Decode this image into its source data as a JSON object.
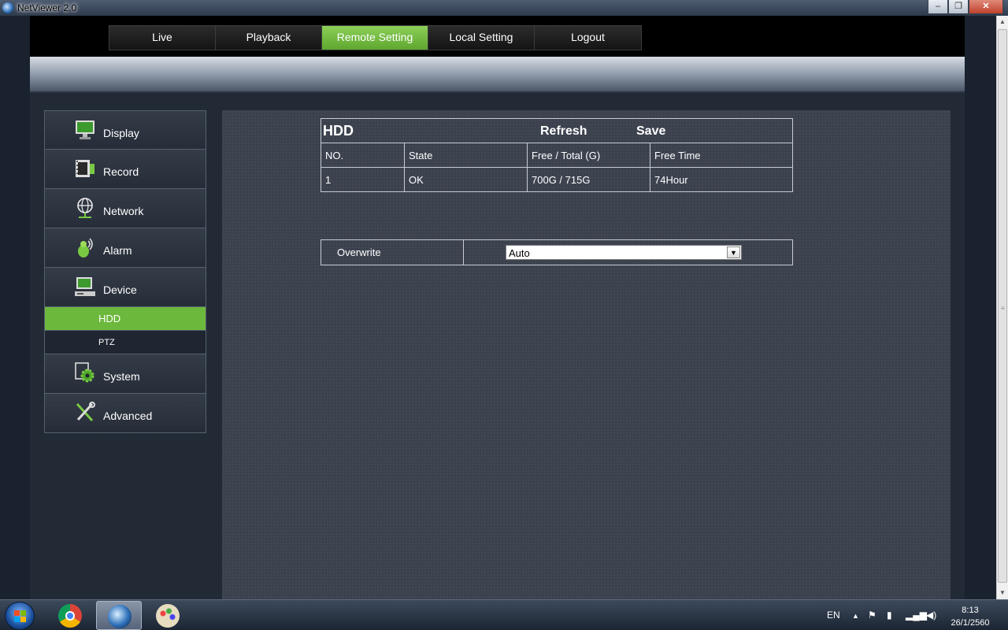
{
  "window": {
    "title": "NetViewer 2.0",
    "minimize": "–",
    "maximize": "❐",
    "close": "✕"
  },
  "nav": {
    "tabs": [
      {
        "label": "Live"
      },
      {
        "label": "Playback"
      },
      {
        "label": "Remote Setting"
      },
      {
        "label": "Local Setting"
      },
      {
        "label": "Logout"
      }
    ],
    "active": "Remote Setting"
  },
  "sidebar": {
    "items": [
      {
        "label": "Display",
        "icon": "monitor-icon"
      },
      {
        "label": "Record",
        "icon": "film-icon"
      },
      {
        "label": "Network",
        "icon": "globe-icon"
      },
      {
        "label": "Alarm",
        "icon": "alarm-icon"
      },
      {
        "label": "Device",
        "icon": "computer-icon"
      }
    ],
    "device_sub": [
      {
        "label": "HDD",
        "active": true
      },
      {
        "label": "PTZ",
        "active": false
      }
    ],
    "items_after": [
      {
        "label": "System",
        "icon": "gear-icon"
      },
      {
        "label": "Advanced",
        "icon": "tools-icon"
      }
    ]
  },
  "hdd": {
    "title": "HDD",
    "refresh": "Refresh",
    "save": "Save",
    "columns": [
      "NO.",
      "State",
      "Free / Total (G)",
      "Free Time"
    ],
    "rows": [
      [
        "1",
        "OK",
        "700G / 715G",
        "74Hour"
      ]
    ]
  },
  "overwrite": {
    "label": "Overwrite",
    "value": "Auto"
  },
  "taskbar": {
    "language": "EN",
    "time": "8:13",
    "date": "26/1/2560"
  },
  "colors": {
    "accent_green": "#6cb83c",
    "panel_bg": "#3b424e",
    "page_bg": "#1c2330"
  }
}
